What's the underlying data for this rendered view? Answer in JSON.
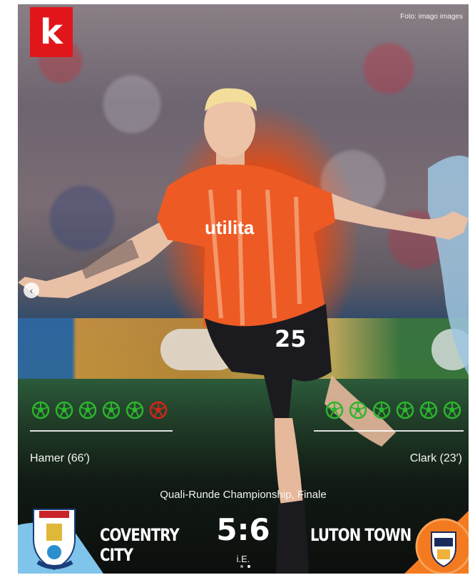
{
  "brand": {
    "logo_letter": "k",
    "photo_credit": "Foto: imago images"
  },
  "match": {
    "competition": "Quali-Runde Championship, Finale",
    "home_team": {
      "line1": "COVENTRY",
      "line2": "CITY",
      "scorer": "Hamer (66′)"
    },
    "away_team": {
      "line1": "LUTON TOWN",
      "scorer": "Clark (23′)"
    },
    "score": "5:6",
    "note": "i.E."
  },
  "penalties": {
    "home": [
      "scored",
      "scored",
      "scored",
      "scored",
      "scored",
      "missed"
    ],
    "away": [
      "scored",
      "scored",
      "scored",
      "scored",
      "scored",
      "scored"
    ]
  },
  "player": {
    "shirt_number": "25",
    "sponsor": "utilita"
  },
  "carousel": {
    "total": 2,
    "active": 2
  },
  "colors": {
    "scored": "#2db52d",
    "missed": "#d4241c",
    "brand_red": "#e0161b",
    "luton_orange": "#f47a20"
  }
}
